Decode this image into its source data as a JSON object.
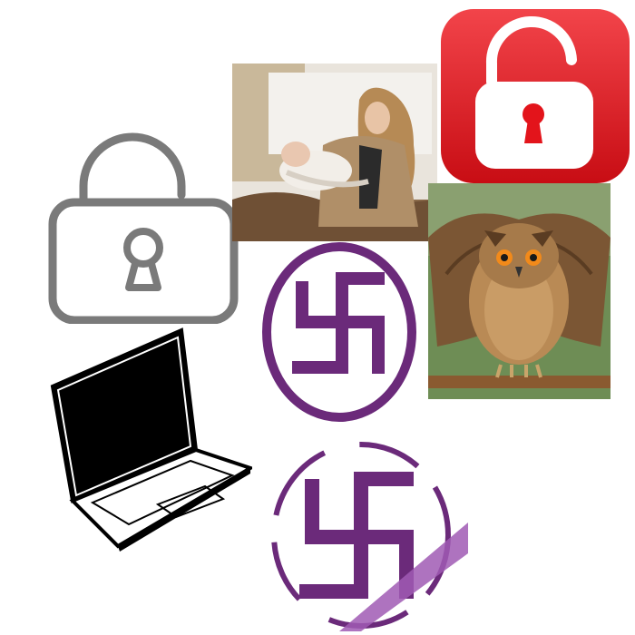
{
  "collage": {
    "tiles": [
      {
        "name": "open-padlock-outline-icon",
        "kind": "icon"
      },
      {
        "name": "mother-holding-baby-photo",
        "kind": "photo"
      },
      {
        "name": "red-unlocked-padlock-app-icon",
        "kind": "icon"
      },
      {
        "name": "eagle-owl-spreading-wings-photo",
        "kind": "photo"
      },
      {
        "name": "purple-swastika-in-circle-symbol",
        "kind": "symbol"
      },
      {
        "name": "laptop-line-drawing-icon",
        "kind": "icon"
      },
      {
        "name": "purple-swastika-crossed-out-symbol",
        "kind": "symbol"
      }
    ]
  },
  "colors": {
    "outline_gray": "#7a7a7a",
    "lock_red": "#e3141b",
    "symbol_purple": "#6b2a7a",
    "strike_lavender": "#a05bb4"
  }
}
